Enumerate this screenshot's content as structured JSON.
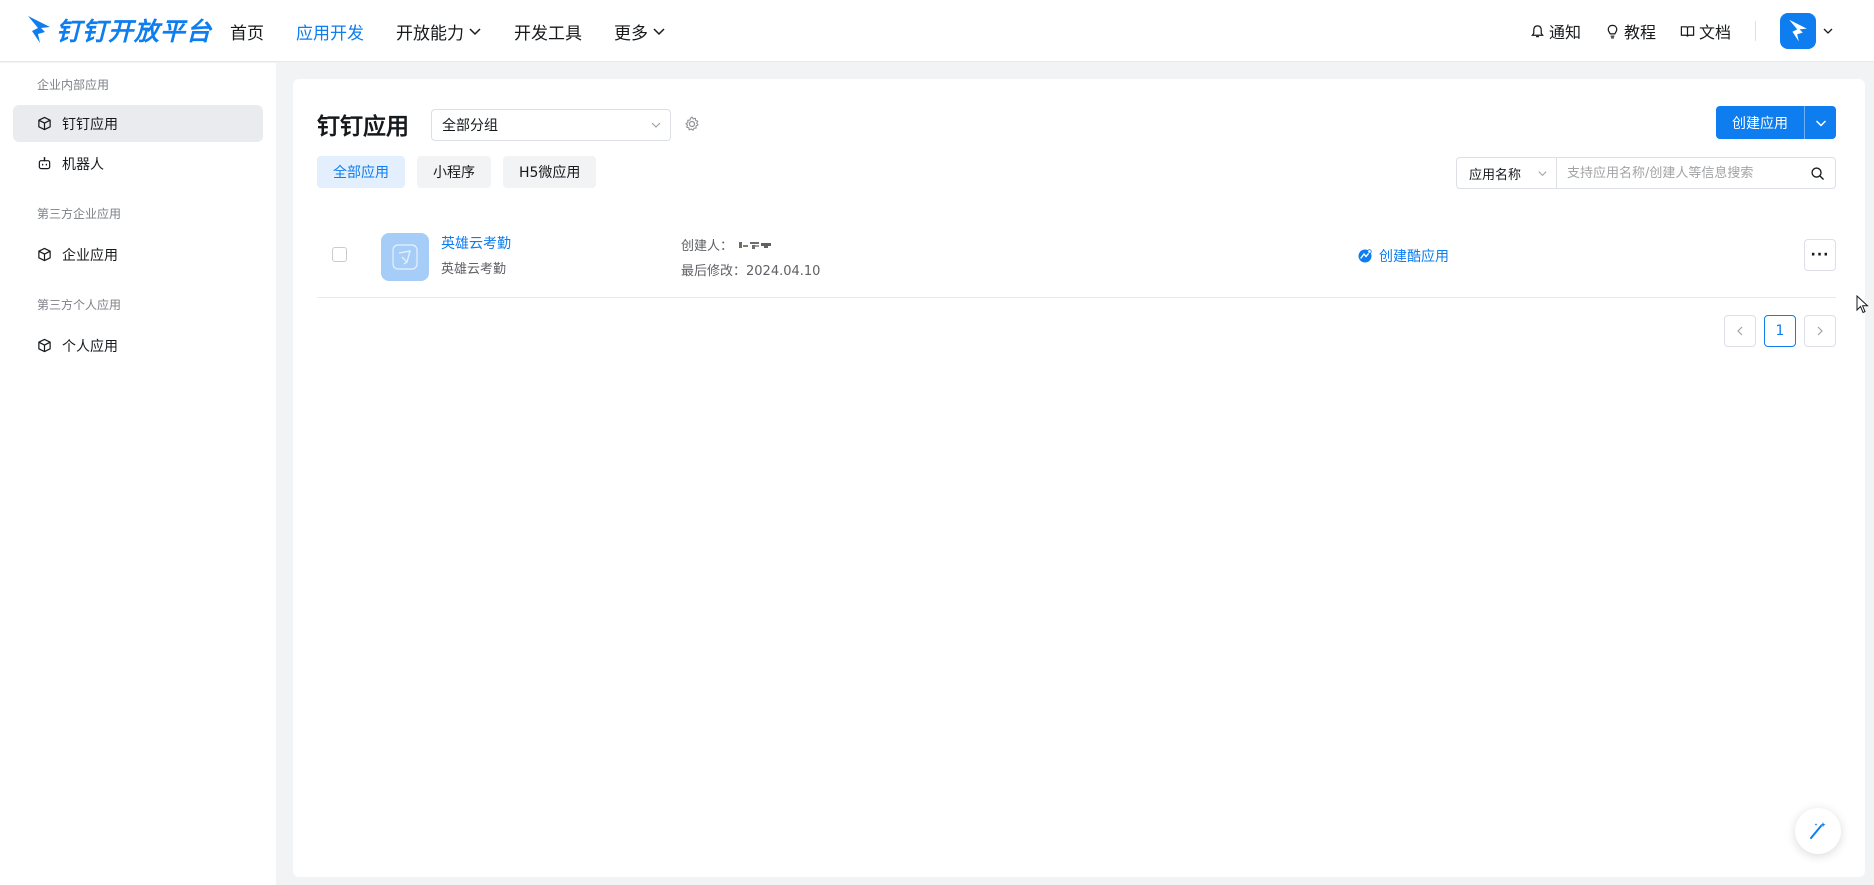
{
  "header": {
    "logo_text": "钉钉开放平台",
    "nav": [
      {
        "label": "首页",
        "active": false,
        "dropdown": false
      },
      {
        "label": "应用开发",
        "active": true,
        "dropdown": false
      },
      {
        "label": "开放能力",
        "active": false,
        "dropdown": true
      },
      {
        "label": "开发工具",
        "active": false,
        "dropdown": false
      },
      {
        "label": "更多",
        "active": false,
        "dropdown": true
      }
    ],
    "tools": {
      "notify": "通知",
      "tutorial": "教程",
      "docs": "文档"
    }
  },
  "sidebar": {
    "groups": [
      {
        "title": "企业内部应用",
        "items": [
          {
            "label": "钉钉应用",
            "icon": "cube-icon",
            "active": true
          },
          {
            "label": "机器人",
            "icon": "robot-icon",
            "active": false
          }
        ]
      },
      {
        "title": "第三方企业应用",
        "items": [
          {
            "label": "企业应用",
            "icon": "cube-icon",
            "active": false
          }
        ]
      },
      {
        "title": "第三方个人应用",
        "items": [
          {
            "label": "个人应用",
            "icon": "cube-icon",
            "active": false
          }
        ]
      }
    ]
  },
  "main": {
    "title": "钉钉应用",
    "group_select": "全部分组",
    "create_button": "创建应用",
    "tabs": [
      {
        "label": "全部应用",
        "active": true
      },
      {
        "label": "小程序",
        "active": false
      },
      {
        "label": "H5微应用",
        "active": false
      }
    ],
    "search": {
      "type": "应用名称",
      "placeholder": "支持应用名称/创建人等信息搜索"
    },
    "apps": [
      {
        "name": "英雄云考勤",
        "desc": "英雄云考勤",
        "creator_label": "创建人：",
        "modified": "最后修改：2024.04.10",
        "cool_app": "创建酷应用"
      }
    ],
    "pagination": {
      "current": "1"
    }
  },
  "colors": {
    "accent": "#0d7df0",
    "app_icon_bg": "#a6cdf7",
    "page_bg": "#f2f3f5"
  }
}
